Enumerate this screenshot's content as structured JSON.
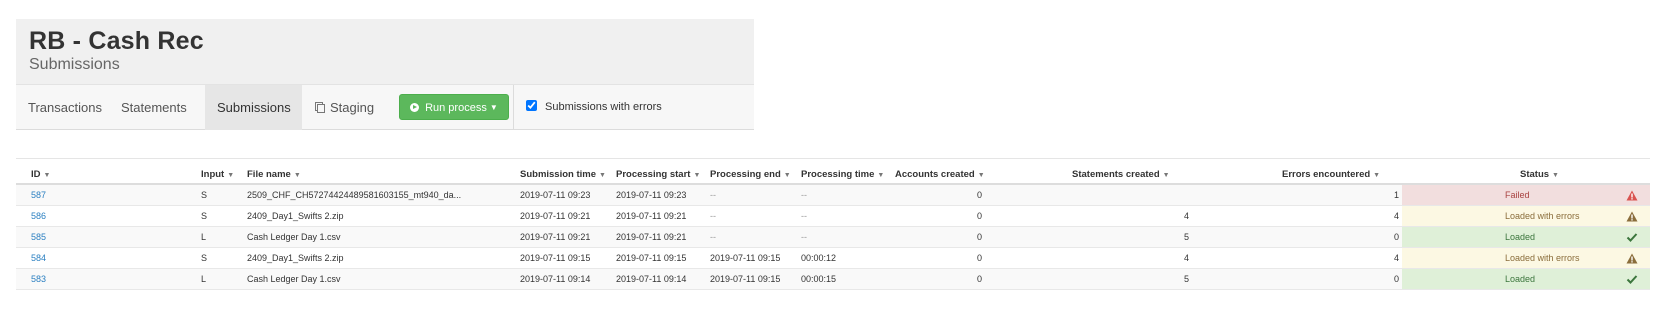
{
  "header": {
    "title": "RB - Cash Rec",
    "subtitle": "Submissions"
  },
  "tabs": {
    "transactions": "Transactions",
    "statements": "Statements",
    "submissions": "Submissions",
    "staging": "Staging"
  },
  "toolbar": {
    "run_process_label": "Run process",
    "errors_filter_label": "Submissions with errors",
    "errors_filter_checked": true
  },
  "table": {
    "columns": {
      "id": "ID",
      "input": "Input",
      "file_name": "File name",
      "submission_time": "Submission time",
      "processing_start": "Processing start",
      "processing_end": "Processing end",
      "processing_time": "Processing time",
      "accounts_created": "Accounts created",
      "statements_created": "Statements created",
      "errors_encountered": "Errors encountered",
      "status": "Status"
    },
    "rows": [
      {
        "id": "587",
        "input": "S",
        "file_name": "2509_CHF_CH5727442448958160315​5_mt940_da...",
        "submission_time": "2019-07-11 09:23",
        "processing_start": "2019-07-11 09:23",
        "processing_end": "--",
        "processing_time": "--",
        "accounts_created": "0",
        "statements_created": "",
        "errors_encountered": "1",
        "status": "Failed",
        "status_kind": "failed"
      },
      {
        "id": "586",
        "input": "S",
        "file_name": "2409_Day1_Swifts 2.zip",
        "submission_time": "2019-07-11 09:21",
        "processing_start": "2019-07-11 09:21",
        "processing_end": "--",
        "processing_time": "--",
        "accounts_created": "0",
        "statements_created": "4",
        "errors_encountered": "4",
        "status": "Loaded with errors",
        "status_kind": "warn"
      },
      {
        "id": "585",
        "input": "L",
        "file_name": "Cash Ledger Day 1.csv",
        "submission_time": "2019-07-11 09:21",
        "processing_start": "2019-07-11 09:21",
        "processing_end": "--",
        "processing_time": "--",
        "accounts_created": "0",
        "statements_created": "5",
        "errors_encountered": "0",
        "status": "Loaded",
        "status_kind": "ok"
      },
      {
        "id": "584",
        "input": "S",
        "file_name": "2409_Day1_Swifts 2.zip",
        "submission_time": "2019-07-11 09:15",
        "processing_start": "2019-07-11 09:15",
        "processing_end": "2019-07-11 09:15",
        "processing_time": "00:00:12",
        "accounts_created": "0",
        "statements_created": "4",
        "errors_encountered": "4",
        "status": "Loaded with errors",
        "status_kind": "warn"
      },
      {
        "id": "583",
        "input": "L",
        "file_name": "Cash Ledger Day 1.csv",
        "submission_time": "2019-07-11 09:14",
        "processing_start": "2019-07-11 09:14",
        "processing_end": "2019-07-11 09:15",
        "processing_time": "00:00:15",
        "accounts_created": "0",
        "statements_created": "5",
        "errors_encountered": "0",
        "status": "Loaded",
        "status_kind": "ok"
      }
    ]
  },
  "colors": {
    "link": "#2a7fc1",
    "run_button": "#5cb85c",
    "failed": "#a94442",
    "warn": "#8a6d3b",
    "ok": "#3c763d"
  }
}
